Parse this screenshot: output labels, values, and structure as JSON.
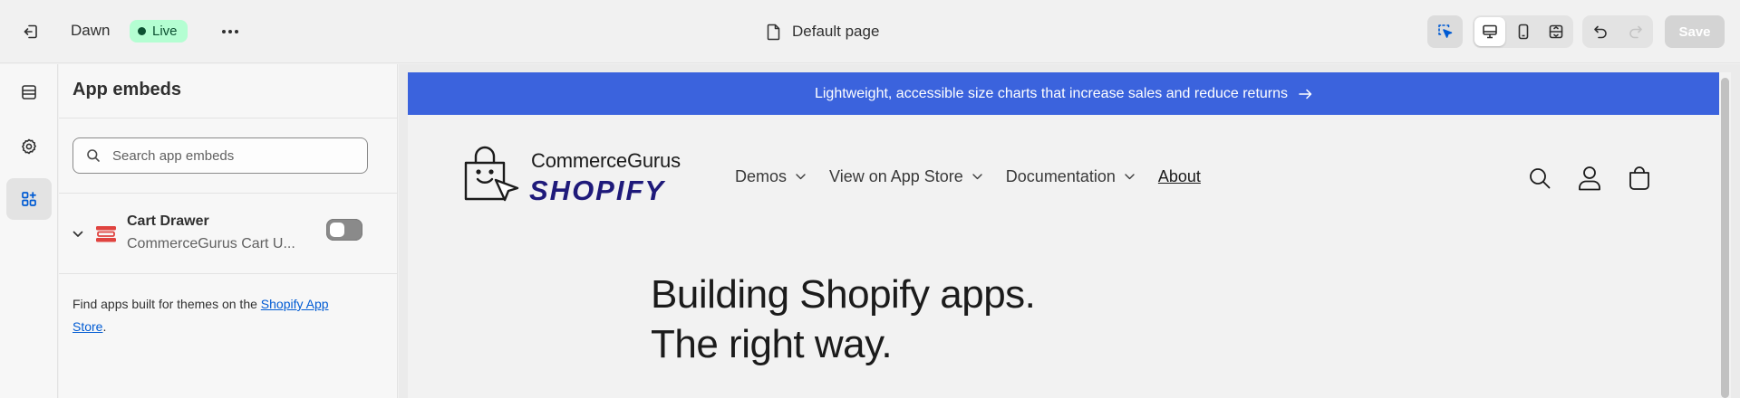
{
  "topbar": {
    "theme_name": "Dawn",
    "status_badge": "Live",
    "page_selector": "Default page",
    "save_label": "Save",
    "icons": [
      "exit-icon",
      "more-icon",
      "page-icon",
      "inspector-icon",
      "desktop-icon",
      "mobile-icon",
      "fullscreen-icon",
      "undo-icon",
      "redo-icon"
    ]
  },
  "rail": {
    "items": [
      {
        "name": "sections",
        "icon": "sections-icon",
        "active": false
      },
      {
        "name": "theme-settings",
        "icon": "gear-icon",
        "active": false
      },
      {
        "name": "app-embeds",
        "icon": "apps-icon",
        "active": true
      }
    ]
  },
  "panel": {
    "title": "App embeds",
    "search_placeholder": "Search app embeds",
    "embed": {
      "name": "Cart Drawer",
      "app": "CommerceGurus Cart U...",
      "enabled": false
    },
    "footer_text": "Find apps built for themes on the ",
    "footer_link": "Shopify App Store",
    "footer_end": "."
  },
  "preview": {
    "announcement": "Lightweight, accessible size charts that increase sales and reduce returns",
    "logo_top": "CommerceGurus",
    "logo_bottom": "SHOPIFY",
    "nav": [
      {
        "label": "Demos",
        "dropdown": true
      },
      {
        "label": "View on App Store",
        "dropdown": true
      },
      {
        "label": "Documentation",
        "dropdown": true
      },
      {
        "label": "About",
        "dropdown": false,
        "current": true
      }
    ],
    "hero_line1": "Building Shopify apps.",
    "hero_line2": "The right way."
  },
  "colors": {
    "announcement_bg": "#3b63dd",
    "live_badge_bg": "#b4fed2",
    "link": "#005bd3",
    "logo_accent": "#1f1a7a"
  }
}
